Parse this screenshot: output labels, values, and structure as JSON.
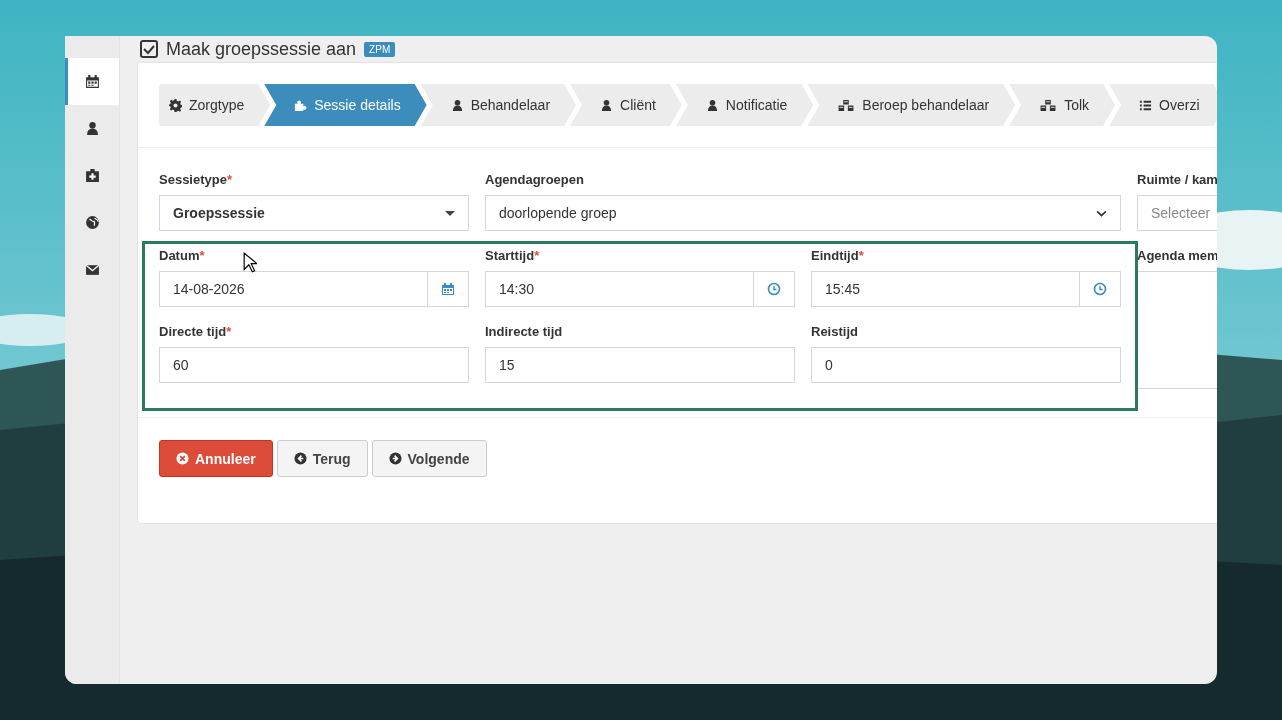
{
  "header": {
    "title": "Maak groepssessie aan",
    "badge": "ZPM"
  },
  "sidebar": {
    "items": [
      {
        "selected": true
      },
      {
        "selected": false
      },
      {
        "selected": false
      },
      {
        "selected": false
      },
      {
        "selected": false
      }
    ]
  },
  "steps": [
    {
      "label": "Zorgtype",
      "selected": false
    },
    {
      "label": "Sessie details",
      "selected": true
    },
    {
      "label": "Behandelaar",
      "selected": false
    },
    {
      "label": "Cliënt",
      "selected": false
    },
    {
      "label": "Notificatie",
      "selected": false
    },
    {
      "label": "Beroep behandelaar",
      "selected": false
    },
    {
      "label": "Tolk",
      "selected": false
    },
    {
      "label": "Overzi",
      "selected": false
    }
  ],
  "form": {
    "rows": [
      [
        {
          "kind": "select",
          "label": "Sessietype",
          "mark": "*",
          "value": "Groepssessie"
        },
        {
          "kind": "wide-select",
          "label": "Agendagroepen",
          "value": "doorlopende groep"
        }
      ],
      [
        {
          "kind": "date",
          "label": "Datum",
          "mark": "*",
          "value": "14-08-2026"
        },
        {
          "kind": "time",
          "label": "Starttijd",
          "mark": "*",
          "value": "14:30"
        },
        {
          "kind": "time",
          "label": "Eindtijd",
          "mark": "*",
          "value": "15:45"
        }
      ],
      [
        {
          "kind": "text",
          "label": "Directe tijd",
          "mark": "*",
          "value": "60"
        },
        {
          "kind": "text",
          "label": "Indirecte tijd",
          "value": "15"
        },
        {
          "kind": "text",
          "label": "Reistijd",
          "value": "0"
        }
      ]
    ]
  },
  "side_fields": [
    {
      "kind": "placeholder",
      "label": "Ruimte / kam",
      "placeholder": "Selecteer"
    },
    {
      "kind": "textarea",
      "label": "Agenda mem"
    }
  ],
  "buttons": [
    {
      "kind": "danger",
      "label": "Annuleer"
    },
    {
      "kind": "default",
      "label": "Terug"
    },
    {
      "kind": "default",
      "label": "Volgende"
    }
  ]
}
